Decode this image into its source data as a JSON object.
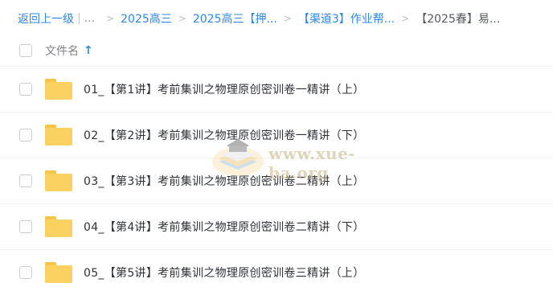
{
  "breadcrumb": {
    "back_label": "返回上一级",
    "ellipsis": "...",
    "items": [
      "2025高三",
      "2025高三【押...",
      "【渠道3】作业帮...",
      "【2025春】易..."
    ]
  },
  "list_header": {
    "column_title": "文件名",
    "sort_icon": "arrow-up-icon"
  },
  "files": [
    {
      "name": "01_【第1讲】考前集训之物理原创密训卷一精讲（上）",
      "icon": "folder-icon"
    },
    {
      "name": "02_【第2讲】考前集训之物理原创密训卷一精讲（下）",
      "icon": "folder-icon"
    },
    {
      "name": "03_【第3讲】考前集训之物理原创密训卷二精讲（上）",
      "icon": "folder-icon"
    },
    {
      "name": "04_【第4讲】考前集训之物理原创密训卷二精讲（下）",
      "icon": "folder-icon"
    },
    {
      "name": "05_【第5讲】考前集训之物理原创密训卷三精讲（上）",
      "icon": "folder-icon"
    }
  ],
  "watermark": {
    "text": "www.xue-ba.org"
  },
  "colors": {
    "link": "#2f87e8",
    "folder": "#fbd161",
    "text": "#2d3238",
    "muted": "#7d838b"
  }
}
